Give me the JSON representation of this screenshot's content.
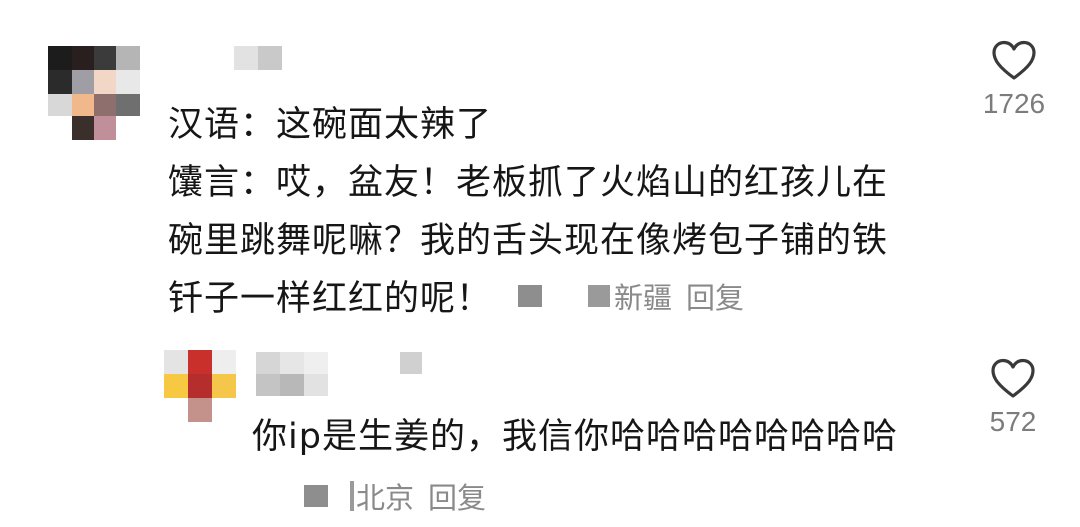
{
  "comments": [
    {
      "lines": [
        "汉语：这碗面太辣了",
        "馕言：哎，盆友！老板抓了火焰山的红孩儿在",
        "碗里跳舞呢嘛？我的舌头现在像烤包子铺的铁",
        "钎子一样红红的呢！"
      ],
      "location": "新疆",
      "reply_label": "回复",
      "like_count": "1726",
      "like_icon": "heart-outline-icon"
    },
    {
      "text": "你ip是生姜的，我信你哈哈哈哈哈哈哈哈",
      "location": "北京",
      "reply_label": "回复",
      "like_count": "572",
      "like_icon": "heart-outline-icon"
    }
  ],
  "colors": {
    "text": "#161616",
    "meta": "#8a8a8a",
    "like_count": "#7c7c7c",
    "heart_stroke": "#3a3a3a"
  }
}
